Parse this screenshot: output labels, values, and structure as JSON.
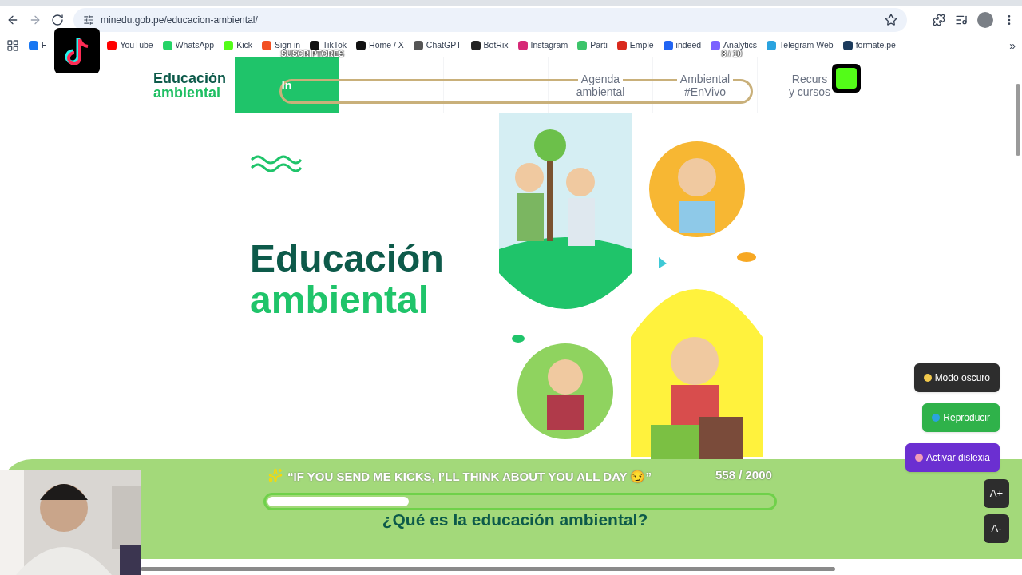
{
  "browser": {
    "url": "minedu.gob.pe/educacion-ambiental/",
    "bookmarks": [
      {
        "label": "F",
        "color": "#1877f2"
      },
      {
        "label": "YouTube",
        "color": "#ff0000"
      },
      {
        "label": "WhatsApp",
        "color": "#25d366"
      },
      {
        "label": "Kick",
        "color": "#53fc18"
      },
      {
        "label": "Sign in",
        "color": "#f25022"
      },
      {
        "label": "TikTok",
        "color": "#111111"
      },
      {
        "label": "Home / X",
        "color": "#111111"
      },
      {
        "label": "ChatGPT",
        "color": "#555555"
      },
      {
        "label": "BotRix",
        "color": "#222222"
      },
      {
        "label": "Instagram",
        "color": "#d62976"
      },
      {
        "label": "Parti",
        "color": "#3cc46a"
      },
      {
        "label": "Emple",
        "color": "#d9291c"
      },
      {
        "label": "indeed",
        "color": "#2164f3"
      },
      {
        "label": "Analytics",
        "color": "#7b61ff"
      },
      {
        "label": "Telegram Web",
        "color": "#2aa3df"
      },
      {
        "label": "formate.pe",
        "color": "#1b3a5c"
      }
    ],
    "more": "»"
  },
  "site": {
    "logo": [
      "Educación",
      "ambiental"
    ],
    "nav": [
      {
        "lines": [
          "In"
        ],
        "selected": true
      },
      {
        "selected": false
      },
      {
        "selected": false
      },
      {
        "lines": [
          "Agenda",
          "ambiental"
        ],
        "selected": false
      },
      {
        "lines": [
          "Ambiental",
          "#EnVivo"
        ],
        "selected": false
      },
      {
        "lines": [
          "Recurs",
          "y cursos"
        ],
        "selected": false
      }
    ],
    "hero_title": [
      "Educación",
      "ambiental"
    ],
    "section_title": "¿Qué es la educación ambiental?",
    "floating_buttons": [
      {
        "label": "Modo oscuro",
        "kind": "dark"
      },
      {
        "label": "Reproducir",
        "kind": "green"
      },
      {
        "label": "Activar dislexia",
        "kind": "purple"
      }
    ],
    "font_buttons": [
      "A+",
      "A-"
    ]
  },
  "stream": {
    "subs_label": "SUSCRIPTORES",
    "subs_count": "8 / 10",
    "goal_text": "“IF YOU SEND ME KICKS, I’LL THINK ABOUT YOU ALL DAY 😏”",
    "goal_count": "558 / 2000",
    "level": 0.28
  }
}
